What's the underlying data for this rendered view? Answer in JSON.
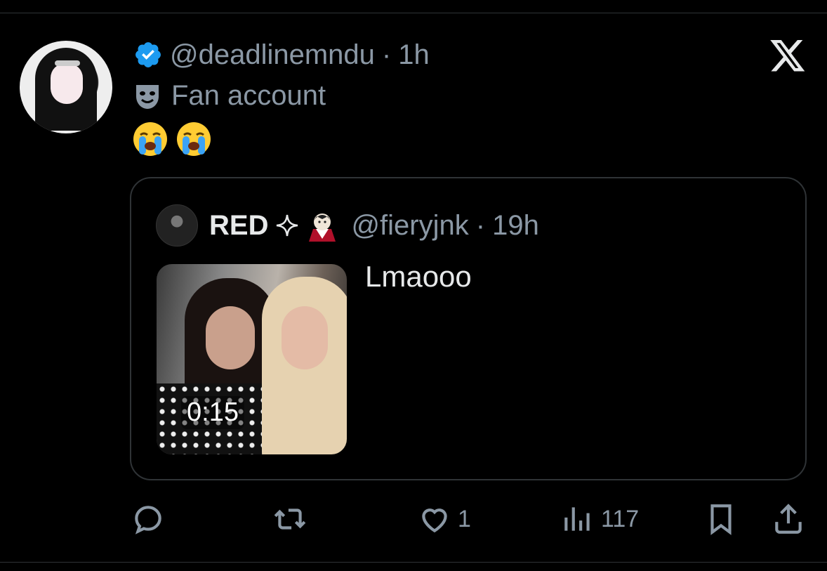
{
  "tweet": {
    "handle": "@deadlinemndu",
    "time_sep": "·",
    "time": "1h",
    "label": "Fan account",
    "emoji_text": "😭😭",
    "icons": {
      "verified": "verified-badge-icon",
      "label_icon": "theater-mask-icon",
      "brand": "x-logo-icon"
    }
  },
  "quote": {
    "name": "RED",
    "handle": "@fieryjnk",
    "time_sep": "·",
    "time": "19h",
    "text": "Lmaooo",
    "media_duration": "0:15"
  },
  "actions": {
    "reply_count": "",
    "retweet_count": "",
    "like_count": "1",
    "views_count": "117"
  },
  "colors": {
    "background": "#000000",
    "text": "#e7e9ea",
    "muted": "#8b98a5",
    "border": "#2f3336",
    "verified_blue": "#1d9bf0"
  }
}
